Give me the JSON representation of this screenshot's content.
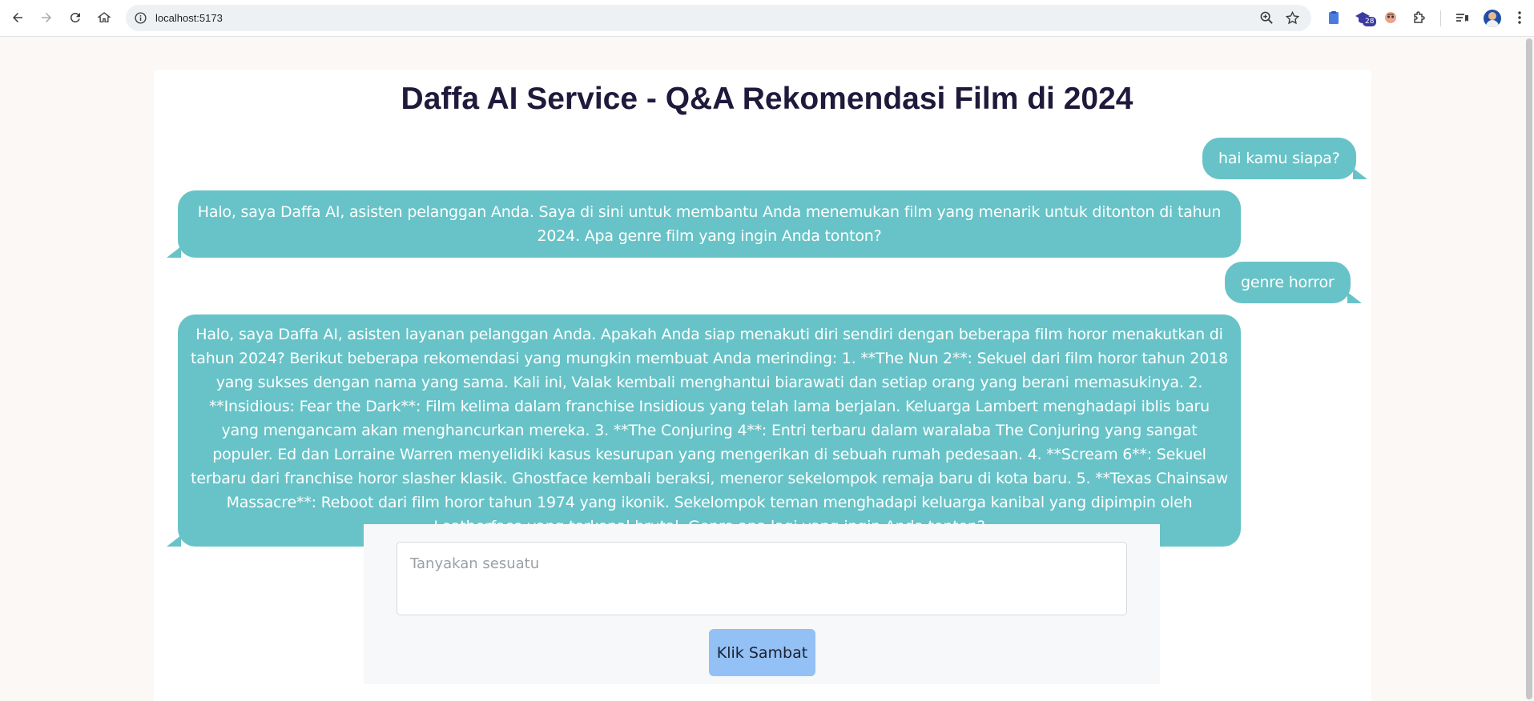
{
  "browser": {
    "url": "localhost:5173",
    "extension_badge": "28"
  },
  "page": {
    "title": "Daffa AI Service - Q&A Rekomendasi Film di 2024"
  },
  "messages": [
    {
      "role": "user",
      "text": "hai kamu siapa?"
    },
    {
      "role": "bot",
      "text": "Halo, saya Daffa AI, asisten pelanggan Anda. Saya di sini untuk membantu Anda menemukan film yang menarik untuk ditonton di tahun 2024. Apa genre film yang ingin Anda tonton?"
    },
    {
      "role": "user",
      "text": "genre horror"
    },
    {
      "role": "bot",
      "text": "Halo, saya Daffa AI, asisten layanan pelanggan Anda. Apakah Anda siap menakuti diri sendiri dengan beberapa film horor menakutkan di tahun 2024? Berikut beberapa rekomendasi yang mungkin membuat Anda merinding: 1. **The Nun 2**: Sekuel dari film horor tahun 2018 yang sukses dengan nama yang sama. Kali ini, Valak kembali menghantui biarawati dan setiap orang yang berani memasukinya. 2. **Insidious: Fear the Dark**: Film kelima dalam franchise Insidious yang telah lama berjalan. Keluarga Lambert menghadapi iblis baru yang mengancam akan menghancurkan mereka. 3. **The Conjuring 4**: Entri terbaru dalam waralaba The Conjuring yang sangat populer. Ed dan Lorraine Warren menyelidiki kasus kesurupan yang mengerikan di sebuah rumah pedesaan. 4. **Scream 6**: Sekuel terbaru dari franchise horor slasher klasik. Ghostface kembali beraksi, meneror sekelompok remaja baru di kota baru. 5. **Texas Chainsaw Massacre**: Reboot dari film horor tahun 1974 yang ikonik. Sekelompok teman menghadapi keluarga kanibal yang dipimpin oleh Leatherface yang terkenal brutal. Genre apa lagi yang ingin Anda tonton?"
    }
  ],
  "composer": {
    "placeholder": "Tanyakan sesuatu",
    "value": "",
    "send_label": "Klik Sambat"
  },
  "colors": {
    "bubble": "#67c3c7",
    "button": "#93c0f5",
    "page_bg": "#fbf8f6"
  },
  "icons": {
    "back": "arrow-left-icon",
    "forward": "arrow-right-icon",
    "reload": "reload-icon",
    "home": "home-icon",
    "site_info": "info-circle-icon",
    "zoom": "zoom-icon",
    "bookmark": "star-icon",
    "extensions": "puzzle-icon",
    "reading_list": "reading-list-icon",
    "menu": "kebab-menu-icon"
  }
}
